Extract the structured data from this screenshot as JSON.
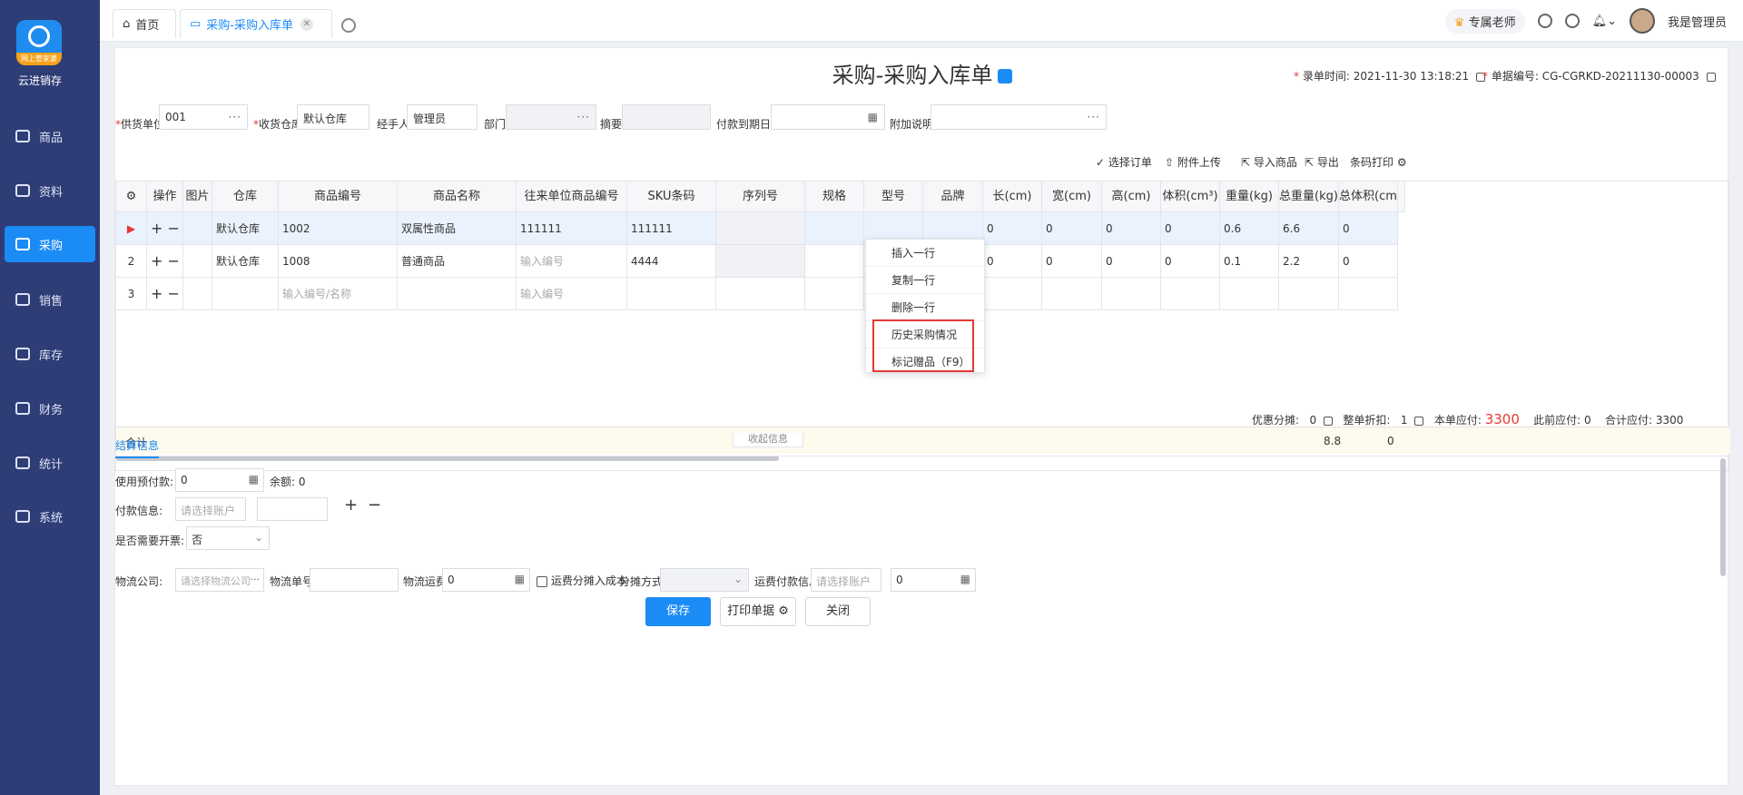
{
  "app": {
    "brand": "云进销存",
    "logo_badge": "网上管家婆",
    "accent": "#1b8bf5",
    "sidebar_bg": "#2f3d76"
  },
  "sidebar": {
    "items": [
      {
        "label": "商品",
        "icon": "box-icon"
      },
      {
        "label": "资料",
        "icon": "document-icon"
      },
      {
        "label": "采购",
        "icon": "purchase-icon",
        "active": true
      },
      {
        "label": "销售",
        "icon": "chart-icon"
      },
      {
        "label": "库存",
        "icon": "warehouse-icon"
      },
      {
        "label": "财务",
        "icon": "wallet-icon"
      },
      {
        "label": "统计",
        "icon": "stats-icon"
      },
      {
        "label": "系统",
        "icon": "settings-icon"
      }
    ]
  },
  "tabs": {
    "home": "首页",
    "active": "采购-采购入库单"
  },
  "topright": {
    "teacher": "专属老师",
    "user": "我是管理员"
  },
  "page": {
    "title": "采购-采购入库单",
    "entry_time_label": "录单时间:",
    "entry_time": "2021-11-30 13:18:21",
    "doc_no_label": "单据编号:",
    "doc_no": "CG-CGRKD-20211130-00003"
  },
  "form": {
    "supplier_label": "供货单位",
    "supplier": "001",
    "warehouse_label": "收货仓库",
    "warehouse": "默认仓库",
    "handler_label": "经手人",
    "handler": "管理员",
    "dept_label": "部门",
    "summary_label": "摘要",
    "due_label": "付款到期日期",
    "note_label": "附加说明"
  },
  "toolbar": {
    "select_order": "选择订单",
    "upload": "附件上传",
    "import": "导入商品",
    "export": "导出",
    "barcode": "条码打印"
  },
  "table": {
    "headers": [
      "操作",
      "图片",
      "仓库",
      "商品编号",
      "商品名称",
      "往来单位商品编号",
      "SKU条码",
      "序列号",
      "规格",
      "型号",
      "品牌",
      "长(cm)",
      "宽(cm)",
      "高(cm)",
      "体积(cm³)",
      "重量(kg)",
      "总重量(kg)",
      "总体积(cm³)"
    ],
    "rows": [
      {
        "no": "",
        "warehouse": "默认仓库",
        "code": "1002",
        "name": "双属性商品",
        "partner_code": "111111",
        "sku": "111111",
        "len": "0",
        "wid": "0",
        "hei": "0",
        "vol": "0",
        "weight": "0.6",
        "total_weight": "6.6",
        "total_vol": "0"
      },
      {
        "no": "2",
        "warehouse": "默认仓库",
        "code": "1008",
        "name": "普通商品",
        "partner_code": "输入编号",
        "sku": "4444",
        "len": "0",
        "wid": "0",
        "hei": "0",
        "vol": "0",
        "weight": "0.1",
        "total_weight": "2.2",
        "total_vol": "0"
      },
      {
        "no": "3",
        "code_ph": "输入编号/名称",
        "partner_ph": "输入编号"
      }
    ],
    "total_label": "合计",
    "total_weight": "8.8",
    "total_vol": "0"
  },
  "context_menu": [
    "插入一行",
    "复制一行",
    "删除一行",
    "历史采购情况",
    "标记赠品（F9）"
  ],
  "summary": {
    "discount_label": "优惠分摊:",
    "discount": "0",
    "whole_label": "整单折扣:",
    "whole": "1",
    "due_label": "本单应付:",
    "due": "3300",
    "prev_label": "此前应付:",
    "prev": "0",
    "total_label": "合计应付:",
    "total": "3300"
  },
  "collapse_label": "收起信息",
  "settle": {
    "tab": "结算信息",
    "prepay_label": "使用预付款:",
    "prepay": "0",
    "balance_label": "余额:",
    "balance": "0",
    "payinfo_label": "付款信息:",
    "account_ph": "请选择账户",
    "invoice_label": "是否需要开票:",
    "invoice": "否",
    "logistics_label": "物流公司:",
    "logistics_ph": "请选择物流公司",
    "tracking_label": "物流单号",
    "freight_label": "物流运费",
    "freight": "0",
    "freight_cost_label": "运费分摊入成本",
    "split_label": "分摊方式:",
    "freight_pay_label": "运费付款信息",
    "freight_pay": "0"
  },
  "buttons": {
    "save": "保存",
    "print": "打印单据",
    "close": "关闭"
  }
}
